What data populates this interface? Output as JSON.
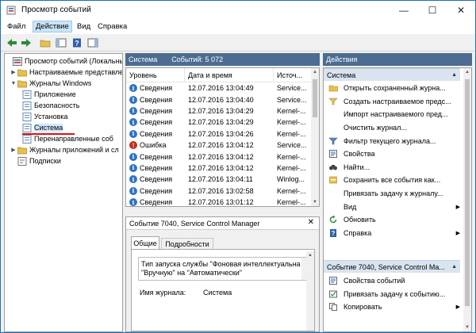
{
  "window": {
    "title": "Просмотр событий"
  },
  "menu": {
    "file": "Файл",
    "action": "Действие",
    "view": "Вид",
    "help": "Справка"
  },
  "tree": {
    "root": "Просмотр событий (Локальны",
    "custom_views": "Настраиваемые представле",
    "windows_logs": "Журналы Windows",
    "application": "Приложение",
    "security": "Безопасность",
    "setup": "Установка",
    "system": "Система",
    "forwarded": "Перенаправленные соб",
    "app_services_logs": "Журналы приложений и сл",
    "subscriptions": "Подписки"
  },
  "log_header": {
    "name": "Система",
    "count": "Событий: 5 072"
  },
  "columns": {
    "level": "Уровень",
    "datetime": "Дата и время",
    "source": "Источ..."
  },
  "events": [
    {
      "level": "Сведения",
      "type": "info",
      "datetime": "12.07.2016 13:04:49",
      "source": "Service..."
    },
    {
      "level": "Сведения",
      "type": "info",
      "datetime": "12.07.2016 13:04:40",
      "source": "Service..."
    },
    {
      "level": "Сведения",
      "type": "info",
      "datetime": "12.07.2016 13:04:29",
      "source": "Kernel-..."
    },
    {
      "level": "Сведения",
      "type": "info",
      "datetime": "12.07.2016 13:04:29",
      "source": "Kernel-..."
    },
    {
      "level": "Сведения",
      "type": "info",
      "datetime": "12.07.2016 13:04:26",
      "source": "Kernel-..."
    },
    {
      "level": "Ошибка",
      "type": "err",
      "datetime": "12.07.2016 13:04:12",
      "source": "Service..."
    },
    {
      "level": "Сведения",
      "type": "info",
      "datetime": "12.07.2016 13:04:12",
      "source": "Kernel-..."
    },
    {
      "level": "Сведения",
      "type": "info",
      "datetime": "12.07.2016 13:04:12",
      "source": "Kernel-..."
    },
    {
      "level": "Сведения",
      "type": "info",
      "datetime": "12.07.2016 13:04:11",
      "source": "Winlog..."
    },
    {
      "level": "Сведения",
      "type": "info",
      "datetime": "12.07.2016 13:02:58",
      "source": "Kernel-..."
    },
    {
      "level": "Сведения",
      "type": "info",
      "datetime": "12.07.2016 13:01:12",
      "source": "Kernel-..."
    }
  ],
  "detail": {
    "title": "Событие 7040, Service Control Manager",
    "tab_general": "Общие",
    "tab_details": "Подробности",
    "text_line1": "Тип запуска службы \"Фоновая интеллектуальна",
    "text_line2": "\"Вручную\" на \"Автоматически\"",
    "log_name_label": "Имя журнала:",
    "log_name_value": "Система"
  },
  "actions": {
    "header": "Действия",
    "section1": "Система",
    "items1": [
      {
        "label": "Открыть сохраненный журна...",
        "icon": "open-folder-icon",
        "sub": false
      },
      {
        "label": "Создать настраиваемое предс...",
        "icon": "filter-add-icon",
        "sub": false
      },
      {
        "label": "Импорт настраиваемого пред...",
        "icon": "blank-icon",
        "sub": false
      },
      {
        "label": "Очистить журнал...",
        "icon": "blank-icon",
        "sub": false
      },
      {
        "label": "Фильтр текущего журнала...",
        "icon": "filter-icon",
        "sub": false
      },
      {
        "label": "Свойства",
        "icon": "properties-icon",
        "sub": false
      },
      {
        "label": "Найти...",
        "icon": "binoculars-icon",
        "sub": false
      },
      {
        "label": "Сохранить все события как...",
        "icon": "save-icon",
        "sub": false
      },
      {
        "label": "Привязать задачу к журналу...",
        "icon": "blank-icon",
        "sub": false
      },
      {
        "label": "Вид",
        "icon": "blank-icon",
        "sub": true
      },
      {
        "label": "Обновить",
        "icon": "refresh-icon",
        "sub": false
      },
      {
        "label": "Справка",
        "icon": "help-icon",
        "sub": true
      }
    ],
    "section2": "Событие 7040, Service Control Ma...",
    "items2": [
      {
        "label": "Свойства событий",
        "icon": "event-properties-icon",
        "sub": false
      },
      {
        "label": "Привязать задачу к событию...",
        "icon": "task-icon",
        "sub": false
      },
      {
        "label": "Копировать",
        "icon": "copy-icon",
        "sub": true
      }
    ]
  },
  "colors": {
    "header_bar": "#4c6c91",
    "accent": "#2f73c2",
    "error": "#c42b1c",
    "selection": "#cce8ff",
    "underline": "#e01010"
  }
}
